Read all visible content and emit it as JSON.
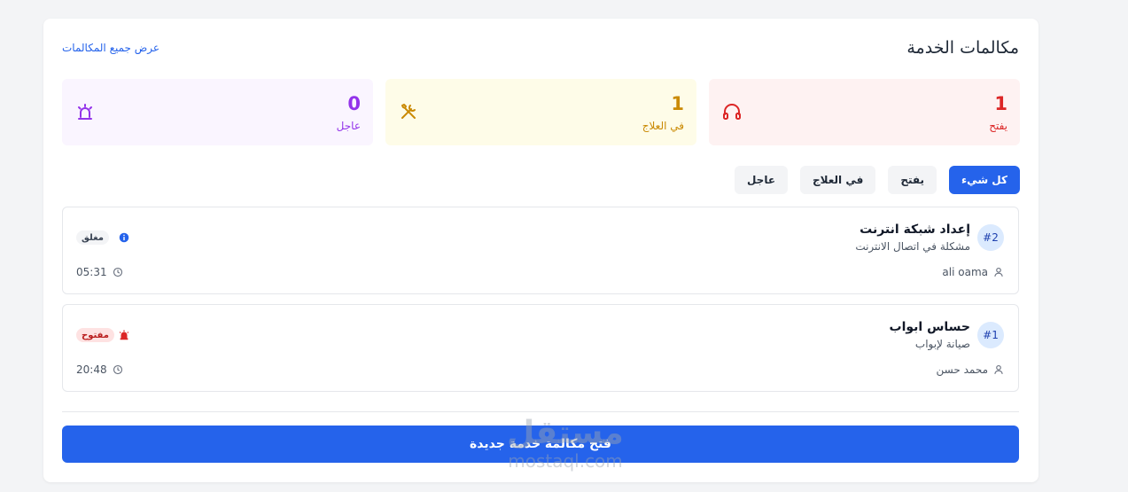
{
  "header": {
    "title": "مكالمات الخدمة",
    "view_all": "عرض جميع المكالمات"
  },
  "stats": [
    {
      "value": "1",
      "label": "يفتح",
      "icon": "headset-icon"
    },
    {
      "value": "1",
      "label": "في العلاج",
      "icon": "tools-icon"
    },
    {
      "value": "0",
      "label": "عاجل",
      "icon": "siren-icon"
    }
  ],
  "filters": [
    "كل شيء",
    "يفتح",
    "في العلاج",
    "عاجل"
  ],
  "calls": [
    {
      "id": "#2",
      "title": "إعداد شبكة انترنت",
      "description": "مشكلة في اتصال الانترنت",
      "status": "مغلق",
      "status_icon": "info-icon",
      "person": "ali oama",
      "time": "05:31"
    },
    {
      "id": "#1",
      "title": "حساس ابواب",
      "description": "صيانة لإبواب",
      "status": "مفتوح",
      "status_icon": "siren-icon",
      "person": "محمد حسن",
      "time": "20:48"
    }
  ],
  "new_call_button": "فتح مكالمة خدمة جديدة",
  "watermark": {
    "line1": "مستقل",
    "line2": "mostaql.com"
  },
  "colors": {
    "accent": "#2563eb",
    "open": "#dc2626",
    "treatment": "#ca8a04",
    "urgent": "#9333ea"
  }
}
